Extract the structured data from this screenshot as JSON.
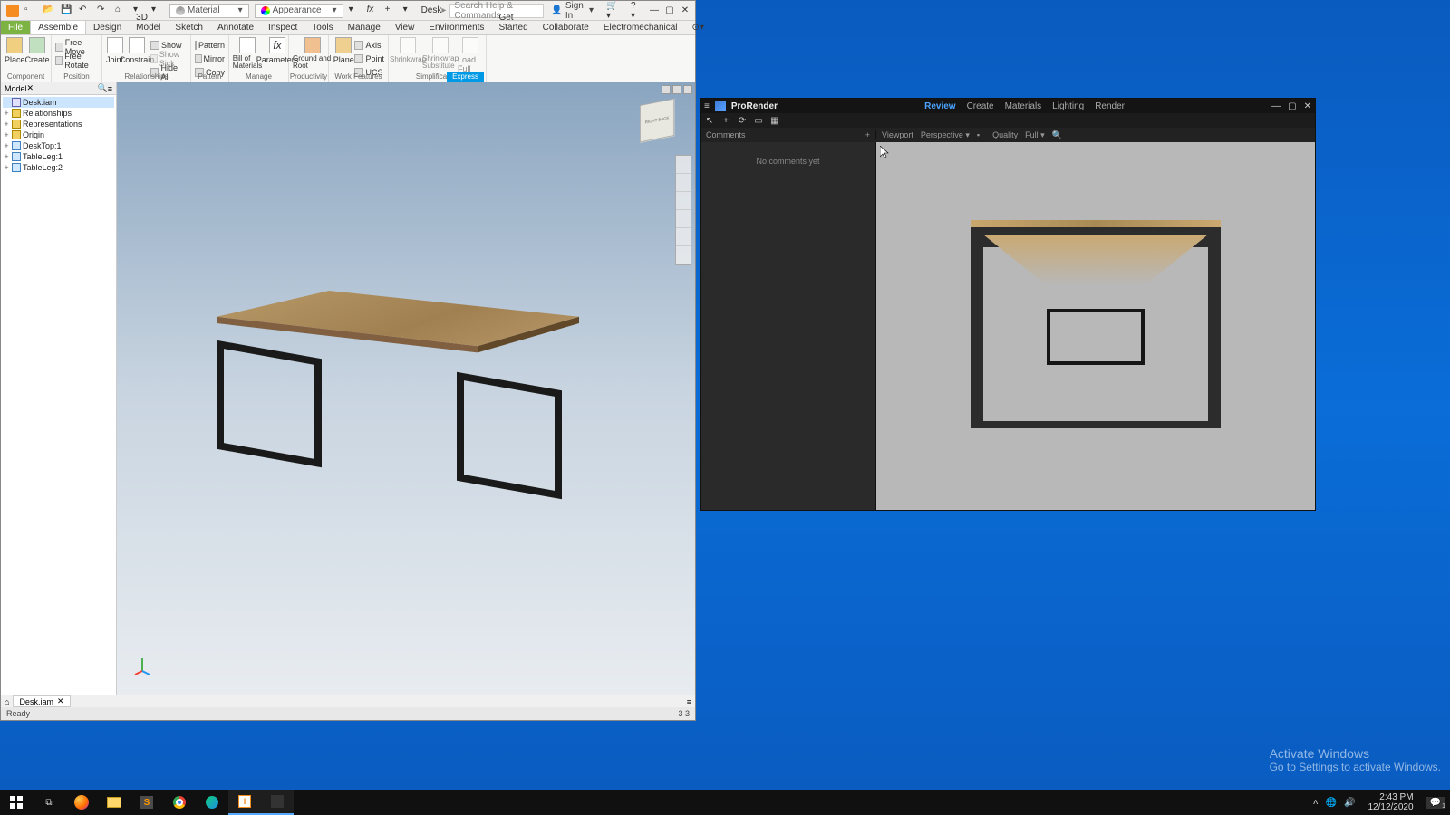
{
  "inventor": {
    "qat": {
      "material": "Material",
      "appearance": "Appearance"
    },
    "doc_title": "Desk",
    "search_placeholder": "Search Help & Commands...",
    "signin": "Sign In",
    "tabs": {
      "file": "File",
      "list": [
        "Assemble",
        "Design",
        "3D Model",
        "Sketch",
        "Annotate",
        "Inspect",
        "Tools",
        "Manage",
        "View",
        "Environments",
        "Get Started",
        "Collaborate",
        "Electromechanical"
      ]
    },
    "ribbon": {
      "place": "Place",
      "create": "Create",
      "free_move": "Free Move",
      "free_rotate": "Free Rotate",
      "joint": "Joint",
      "constrain": "Constrain",
      "show": "Show",
      "show_sick": "Show Sick",
      "hide_all": "Hide All",
      "pattern": "Pattern",
      "mirror": "Mirror",
      "copy": "Copy",
      "bom": "Bill of Materials",
      "parameters": "Parameters",
      "ground": "Ground and Root",
      "plane": "Plane",
      "axis": "Axis",
      "point": "Point",
      "ucs": "UCS",
      "shrinkwrap": "Shrinkwrap",
      "shrinkwrap_sub": "Shrinkwrap Substitute",
      "load_full": "Load Full",
      "groups": {
        "component": "Component",
        "position": "Position",
        "relationships": "Relationships",
        "pattern": "Pattern",
        "manage": "Manage",
        "productivity": "Productivity",
        "work": "Work Features",
        "simplification": "Simplification",
        "express": "Express"
      }
    },
    "browser": {
      "model_tab": "Model",
      "root": "Desk.iam",
      "items": [
        "Relationships",
        "Representations",
        "Origin",
        "DeskTop:1",
        "TableLeg:1",
        "TableLeg:2"
      ]
    },
    "doc_tab": "Desk.iam",
    "home_icon": "⌂",
    "status": {
      "ready": "Ready",
      "right": "3    3"
    }
  },
  "prorender": {
    "title": "ProRender",
    "menu": [
      "Review",
      "Create",
      "Materials",
      "Lighting",
      "Render"
    ],
    "menu_active": 0,
    "comments_label": "Comments",
    "no_comments": "No comments yet",
    "viewport_label": "Viewport",
    "perspective": "Perspective",
    "quality_label": "Quality",
    "quality_value": "Full"
  },
  "watermark": {
    "line1": "Activate Windows",
    "line2": "Go to Settings to activate Windows."
  },
  "taskbar": {
    "clock_time": "2:43 PM",
    "clock_date": "12/12/2020",
    "notif_count": "1"
  }
}
